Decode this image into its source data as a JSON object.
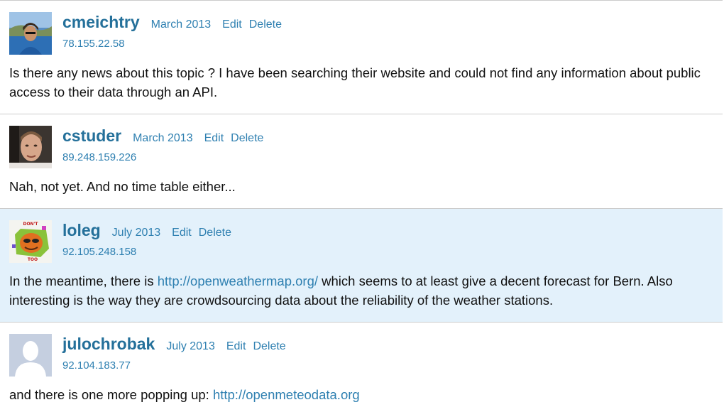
{
  "comments": [
    {
      "username": "cmeichtry",
      "date": "March 2013",
      "edit_label": "Edit",
      "delete_label": "Delete",
      "ip": "78.155.22.58",
      "text": "Is there any news about this topic ? I have been searching their website and could not find any information about public access to their data through an API.",
      "highlighted": false
    },
    {
      "username": "cstuder",
      "date": "March 2013",
      "edit_label": "Edit",
      "delete_label": "Delete",
      "ip": "89.248.159.226",
      "text": "Nah, not yet. And no time table either...",
      "highlighted": false
    },
    {
      "username": "loleg",
      "date": "July 2013",
      "edit_label": "Edit",
      "delete_label": "Delete",
      "ip": "92.105.248.158",
      "text_before": "In the meantime, there is ",
      "link": "http://openweathermap.org/",
      "text_after": " which seems to at least give a decent forecast for Bern. Also interesting is the way they are crowdsourcing data about the reliability of the weather stations.",
      "avatar_text_top": "DON'T",
      "avatar_text_bottom": "TOO",
      "highlighted": true
    },
    {
      "username": "julochrobak",
      "date": "July 2013",
      "edit_label": "Edit",
      "delete_label": "Delete",
      "ip": "92.104.183.77",
      "text_before": "and there is one more popping up: ",
      "link": "http://openmeteodata.org",
      "highlighted": false
    }
  ],
  "colors": {
    "link": "#2f80b1",
    "username": "#24709a",
    "highlight_bg": "#e3f1fb",
    "divider": "#cccccc"
  }
}
